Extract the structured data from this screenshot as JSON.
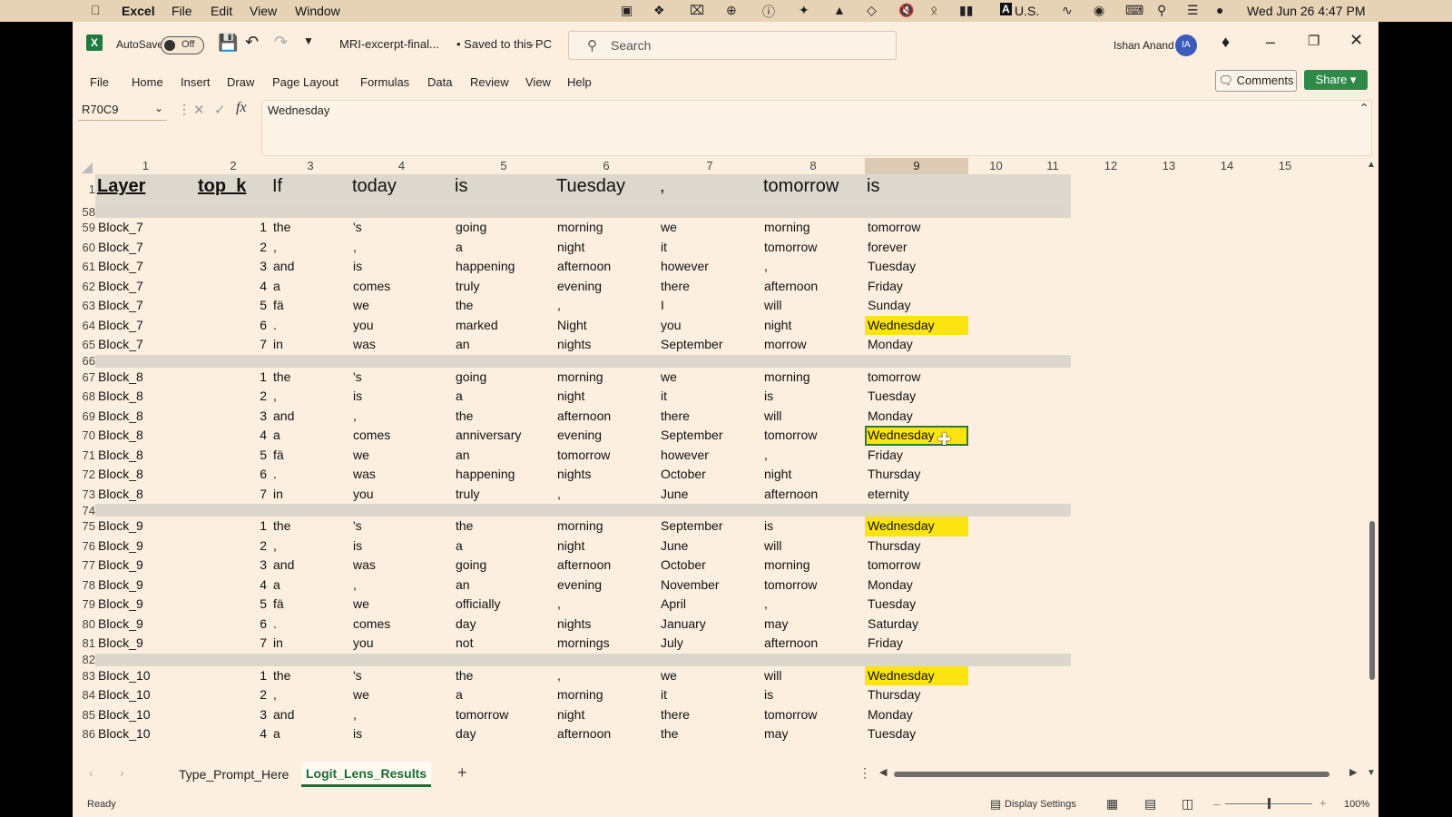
{
  "menubar": {
    "app": "Excel",
    "items": [
      "File",
      "Edit",
      "View",
      "Window"
    ],
    "input_source": "U.S.",
    "datetime": "Wed Jun 26  4:47 PM"
  },
  "titlebar": {
    "autosave_label": "AutoSave",
    "autosave_state": "Off",
    "filename": "MRI-excerpt-final...",
    "saved_status": "• Saved to this PC",
    "search_placeholder": "Search",
    "user_name": "Ishan Anand",
    "user_initials": "IA"
  },
  "ribbon": {
    "tabs": [
      "File",
      "Home",
      "Insert",
      "Draw",
      "Page Layout",
      "Formulas",
      "Data",
      "Review",
      "View",
      "Help"
    ],
    "comments_label": "Comments",
    "share_label": "Share"
  },
  "formula_bar": {
    "name_box": "R70C9",
    "fx": "fx",
    "content": "Wednesday"
  },
  "columns": [
    "1",
    "2",
    "3",
    "4",
    "5",
    "6",
    "7",
    "8",
    "9",
    "10",
    "11",
    "12",
    "13",
    "14",
    "15"
  ],
  "header_row": {
    "row": "1",
    "cells": [
      "Layer",
      "top_k",
      "If",
      "today",
      "is",
      "Tuesday",
      ",",
      "tomorrow",
      "is"
    ]
  },
  "rows": [
    {
      "row": "58",
      "type": "sep"
    },
    {
      "row": "59",
      "cells": [
        "Block_7",
        "1",
        "the",
        "'s",
        "going",
        "morning",
        "we",
        "morning",
        "tomorrow"
      ]
    },
    {
      "row": "60",
      "cells": [
        "Block_7",
        "2",
        ",",
        ",",
        "a",
        "night",
        "it",
        "tomorrow",
        "forever"
      ]
    },
    {
      "row": "61",
      "cells": [
        "Block_7",
        "3",
        "and",
        "is",
        "happening",
        "afternoon",
        "however",
        ",",
        "Tuesday"
      ]
    },
    {
      "row": "62",
      "cells": [
        "Block_7",
        "4",
        "a",
        "comes",
        "truly",
        "evening",
        "there",
        "afternoon",
        "Friday"
      ]
    },
    {
      "row": "63",
      "cells": [
        "Block_7",
        "5",
        "fä",
        "we",
        "the",
        ",",
        "I",
        "will",
        "Sunday"
      ]
    },
    {
      "row": "64",
      "cells": [
        "Block_7",
        "6",
        ".",
        "you",
        "marked",
        "Night",
        "you",
        "night",
        "Wednesday"
      ],
      "hl": true
    },
    {
      "row": "65",
      "cells": [
        "Block_7",
        "7",
        "in",
        "was",
        "an",
        "nights",
        "September",
        "morrow",
        "Monday"
      ]
    },
    {
      "row": "66",
      "type": "sep"
    },
    {
      "row": "67",
      "cells": [
        "Block_8",
        "1",
        "the",
        "'s",
        "going",
        "morning",
        "we",
        "morning",
        "tomorrow"
      ]
    },
    {
      "row": "68",
      "cells": [
        "Block_8",
        "2",
        ",",
        "is",
        "a",
        "night",
        "it",
        "is",
        "Tuesday"
      ]
    },
    {
      "row": "69",
      "cells": [
        "Block_8",
        "3",
        "and",
        ",",
        "the",
        "afternoon",
        "there",
        "will",
        "Monday"
      ]
    },
    {
      "row": "70",
      "cells": [
        "Block_8",
        "4",
        "a",
        "comes",
        "anniversary",
        "evening",
        "September",
        "tomorrow",
        "Wednesday"
      ],
      "hl": true,
      "sel": true
    },
    {
      "row": "71",
      "cells": [
        "Block_8",
        "5",
        "fä",
        "we",
        "an",
        "tomorrow",
        "however",
        ",",
        "Friday"
      ]
    },
    {
      "row": "72",
      "cells": [
        "Block_8",
        "6",
        ".",
        "was",
        "happening",
        "nights",
        "October",
        "night",
        "Thursday"
      ]
    },
    {
      "row": "73",
      "cells": [
        "Block_8",
        "7",
        "in",
        "you",
        "truly",
        ",",
        "June",
        "afternoon",
        "eternity"
      ]
    },
    {
      "row": "74",
      "type": "sep"
    },
    {
      "row": "75",
      "cells": [
        "Block_9",
        "1",
        "the",
        "'s",
        "the",
        "morning",
        "September",
        "is",
        "Wednesday"
      ],
      "hl": true
    },
    {
      "row": "76",
      "cells": [
        "Block_9",
        "2",
        ",",
        "is",
        "a",
        "night",
        "June",
        "will",
        "Thursday"
      ]
    },
    {
      "row": "77",
      "cells": [
        "Block_9",
        "3",
        "and",
        "was",
        "going",
        "afternoon",
        "October",
        "morning",
        "tomorrow"
      ]
    },
    {
      "row": "78",
      "cells": [
        "Block_9",
        "4",
        "a",
        ",",
        "an",
        "evening",
        "November",
        "tomorrow",
        "Monday"
      ]
    },
    {
      "row": "79",
      "cells": [
        "Block_9",
        "5",
        "fä",
        "we",
        "officially",
        ",",
        "April",
        ",",
        "Tuesday"
      ]
    },
    {
      "row": "80",
      "cells": [
        "Block_9",
        "6",
        ".",
        "comes",
        "day",
        "nights",
        "January",
        "may",
        "Saturday"
      ]
    },
    {
      "row": "81",
      "cells": [
        "Block_9",
        "7",
        "in",
        "you",
        "not",
        "mornings",
        "July",
        "afternoon",
        "Friday"
      ]
    },
    {
      "row": "82",
      "type": "sep"
    },
    {
      "row": "83",
      "cells": [
        "Block_10",
        "1",
        "the",
        "'s",
        "the",
        ",",
        "we",
        "will",
        "Wednesday"
      ],
      "hl": true
    },
    {
      "row": "84",
      "cells": [
        "Block_10",
        "2",
        ",",
        "we",
        "a",
        "morning",
        "it",
        "is",
        "Thursday"
      ]
    },
    {
      "row": "85",
      "cells": [
        "Block_10",
        "3",
        "and",
        ",",
        "tomorrow",
        "night",
        "there",
        "tomorrow",
        "Monday"
      ]
    },
    {
      "row": "86",
      "cells": [
        "Block_10",
        "4",
        "a",
        "is",
        "day",
        "afternoon",
        "the",
        "may",
        "Tuesday"
      ]
    }
  ],
  "sheet_tabs": [
    "Type_Prompt_Here",
    "Logit_Lens_Results"
  ],
  "active_sheet": "Logit_Lens_Results",
  "status": {
    "ready": "Ready",
    "display_settings": "Display Settings",
    "zoom": "100%"
  },
  "colors": {
    "highlight": "#fbe40f",
    "sheet_bg": "#fcefdf",
    "accent_green": "#2f8a4a"
  }
}
